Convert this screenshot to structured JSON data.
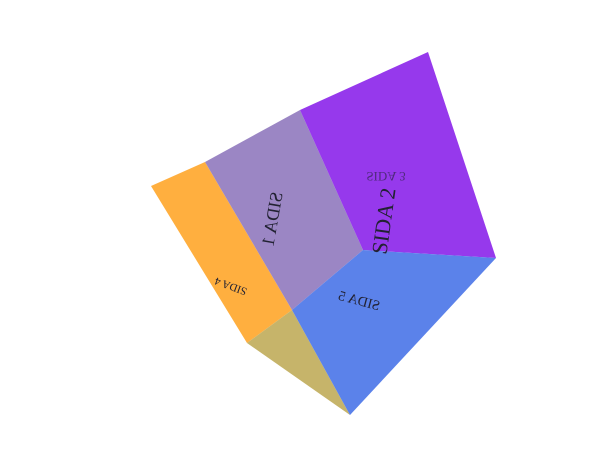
{
  "scene": {
    "faces": [
      {
        "id": "side-1",
        "label": "SIDA 1",
        "color": "#9B86C4"
      },
      {
        "id": "side-2",
        "label": "SIDA 2",
        "color": "#9639EC"
      },
      {
        "id": "side-3",
        "label": "SIDA 3",
        "color": "#9639EC"
      },
      {
        "id": "side-4",
        "label": "SIDA 4",
        "color": "#FFAF3F"
      },
      {
        "id": "side-5",
        "label": "SIDA 5",
        "color": "#5B82EA"
      },
      {
        "id": "bottom-side",
        "label": "",
        "color": "#C6B46A"
      }
    ]
  }
}
